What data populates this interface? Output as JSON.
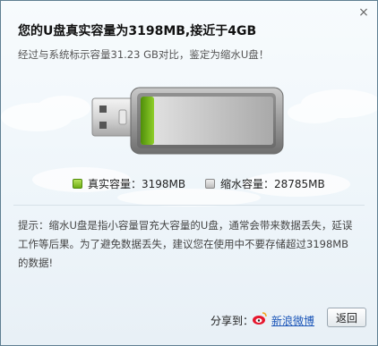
{
  "dialog": {
    "close_glyph": "×",
    "title": "您的U盘真实容量为3198MB,接近于4GB",
    "subtitle": "经过与系统标示容量31.23 GB对比，鉴定为缩水U盘！"
  },
  "usb_drive": {
    "real_fraction": 0.1,
    "colors": {
      "real": "#6fae14",
      "shrink": "#bdbdbd",
      "body": "#8a8a8a"
    }
  },
  "legend": {
    "real_label": "真实容量：3198MB",
    "shrink_label": "缩水容量：28785MB"
  },
  "tip": {
    "text": "提示：缩水U盘是指小容量冒充大容量的U盘，通常会带来数据丢失，延误工作等后果。为了避免数据丢失，建议您在使用中不要存储超过3198MB的数据!"
  },
  "footer": {
    "share_label": "分享到：",
    "weibo_label": "新浪微博",
    "return_label": "返回"
  }
}
